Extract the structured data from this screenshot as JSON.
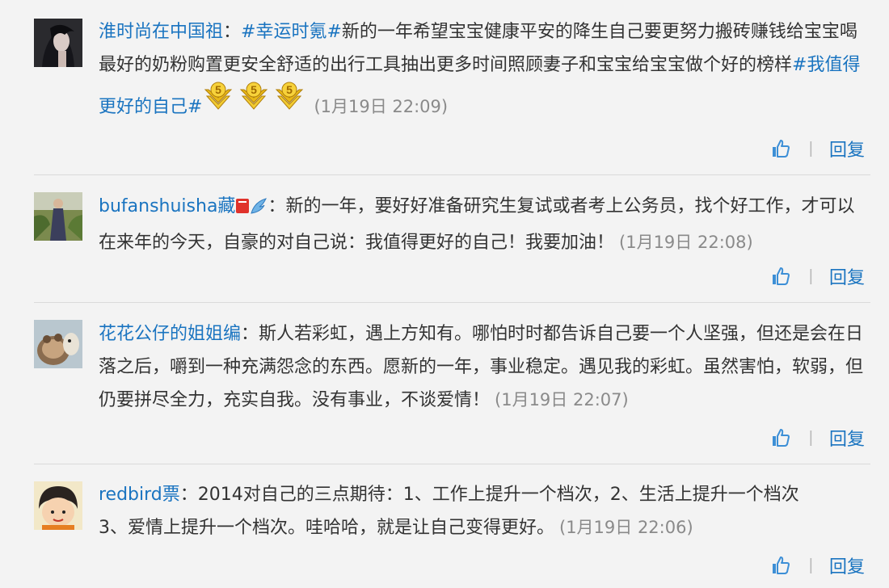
{
  "comments": [
    {
      "username": "淮时尚在中国祖",
      "colon": "：",
      "hashtag1": "#幸运时氪#",
      "body": "新的一年希望宝宝健康平安的降生自己要更努力搬砖赚钱给宝宝喝最好的奶粉购置更安全舒适的出行工具抽出更多时间照顾妻子和宝宝给宝宝做个好的榜样",
      "hashtag2": "#我值得更好的自己#",
      "badge_text": "5",
      "time": "(1月19日 22:09)",
      "reply_label": "回复",
      "separator": "|"
    },
    {
      "username": "bufanshuisha藏",
      "colon": "：",
      "body": "新的一年，要好好准备研究生复试或者考上公务员，找个好工作，才可以在来年的今天，自豪的对自己说：我值得更好的自己！我要加油！",
      "time": "(1月19日 22:08)",
      "reply_label": "回复",
      "separator": "|"
    },
    {
      "username": "花花公仔的姐姐编",
      "colon": "：",
      "body": "斯人若彩虹，遇上方知有。哪怕时时都告诉自己要一个人坚强，但还是会在日落之后，嚼到一种充满怨念的东西。愿新的一年，事业稳定。遇见我的彩虹。虽然害怕，软弱，但仍要拼尽全力，充实自我。没有事业，不谈爱情！",
      "time": "(1月19日 22:07)",
      "reply_label": "回复",
      "separator": "|"
    },
    {
      "username": "redbird票",
      "colon": "：",
      "body_line1": "2014对自己的三点期待：1、工作上提升一个档次，2、生活上提升一个档次",
      "body_line2": "3、爱情上提升一个档次。哇哈哈，就是让自己变得更好。",
      "time": "(1月19日 22:06)",
      "reply_label": "回复",
      "separator": "|"
    }
  ],
  "colors": {
    "link": "#1a74c0",
    "text": "#333333",
    "time": "#8a8a8a",
    "background": "#f3f3f3",
    "like_icon": "#3d8fd6",
    "badge_gold": "#e8b817"
  },
  "icons": {
    "like": "thumbs-up-icon",
    "badge": "vip-level-5-badge",
    "member": "red-book-icon",
    "verified": "blue-wing-icon"
  }
}
